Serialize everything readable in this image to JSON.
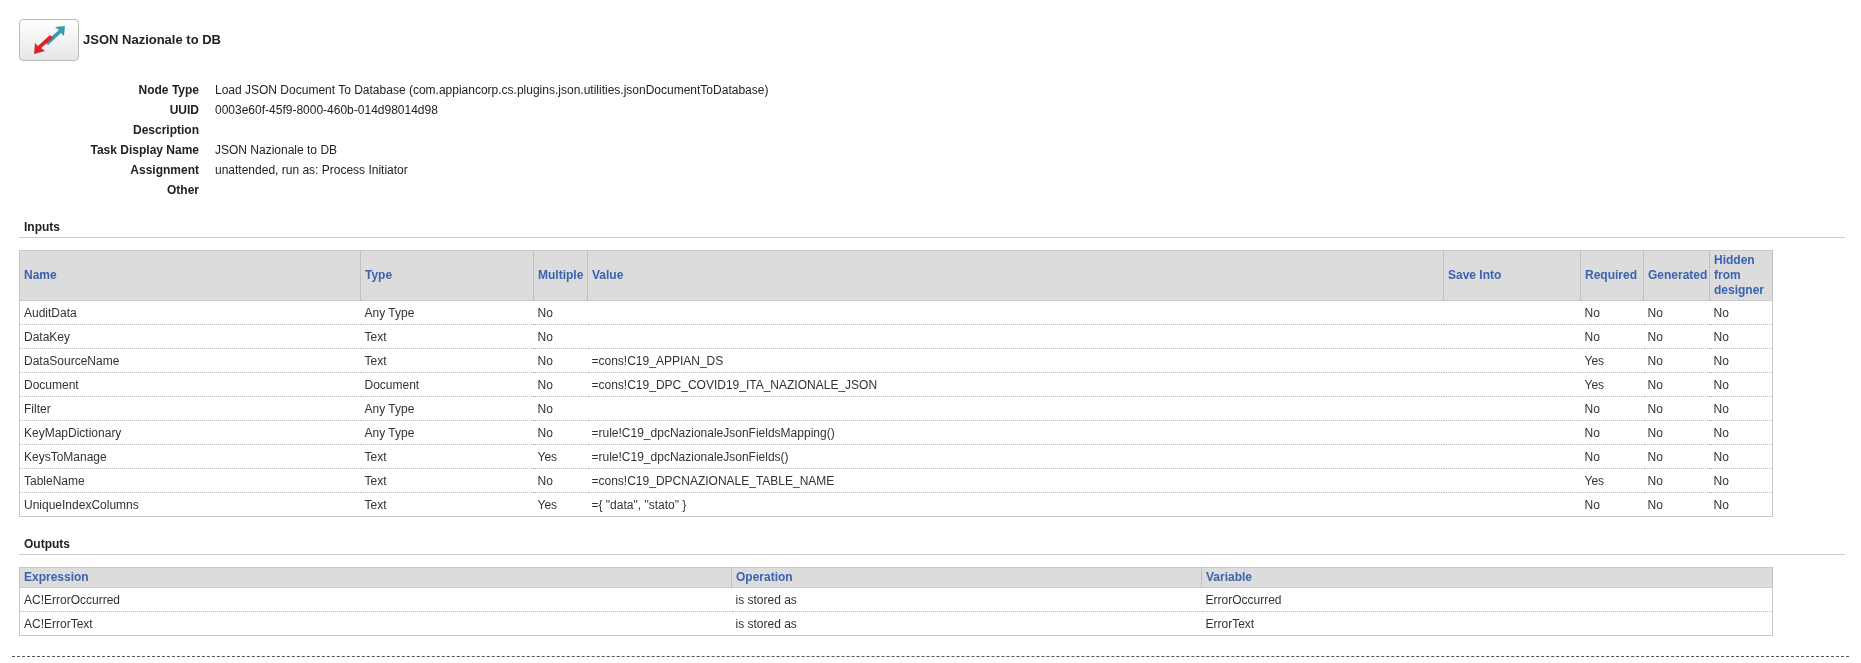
{
  "title": "JSON Nazionale to DB",
  "properties": [
    {
      "label": "Node Type",
      "value": "Load JSON Document To Database (com.appiancorp.cs.plugins.json.utilities.jsonDocumentToDatabase)"
    },
    {
      "label": "UUID",
      "value": "0003e60f-45f9-8000-460b-014d98014d98"
    },
    {
      "label": "Description"
    },
    {
      "label": "Task Display Name",
      "value": "JSON Nazionale to DB"
    },
    {
      "label": "Assignment",
      "value": "unattended, run as: Process Initiator"
    },
    {
      "label": "Other"
    }
  ],
  "inputs": {
    "heading": "Inputs",
    "columns": [
      "Name",
      "Type",
      "Multiple",
      "Value",
      "Save Into",
      "Required",
      "Generated",
      "Hidden from designer"
    ],
    "rows": [
      [
        "AuditData",
        "Any Type",
        "No",
        "",
        "",
        "No",
        "No",
        "No"
      ],
      [
        "DataKey",
        "Text",
        "No",
        "",
        "",
        "No",
        "No",
        "No"
      ],
      [
        "DataSourceName",
        "Text",
        "No",
        "=cons!C19_APPIAN_DS",
        "",
        "Yes",
        "No",
        "No"
      ],
      [
        "Document",
        "Document",
        "No",
        "=cons!C19_DPC_COVID19_ITA_NAZIONALE_JSON",
        "",
        "Yes",
        "No",
        "No"
      ],
      [
        "Filter",
        "Any Type",
        "No",
        "",
        "",
        "No",
        "No",
        "No"
      ],
      [
        "KeyMapDictionary",
        "Any Type",
        "No",
        "=rule!C19_dpcNazionaleJsonFieldsMapping()",
        "",
        "No",
        "No",
        "No"
      ],
      [
        "KeysToManage",
        "Text",
        "Yes",
        "=rule!C19_dpcNazionaleJsonFields()",
        "",
        "No",
        "No",
        "No"
      ],
      [
        "TableName",
        "Text",
        "No",
        "=cons!C19_DPCNAZIONALE_TABLE_NAME",
        "",
        "Yes",
        "No",
        "No"
      ],
      [
        "UniqueIndexColumns",
        "Text",
        "Yes",
        "={ \"data\", \"stato\" }",
        "",
        "No",
        "No",
        "No"
      ]
    ]
  },
  "outputs": {
    "heading": "Outputs",
    "columns": [
      "Expression",
      "Operation",
      "Variable"
    ],
    "rows": [
      [
        "AC!ErrorOccurred",
        "is stored as",
        "ErrorOccurred"
      ],
      [
        "AC!ErrorText",
        "is stored as",
        "ErrorText"
      ]
    ]
  }
}
